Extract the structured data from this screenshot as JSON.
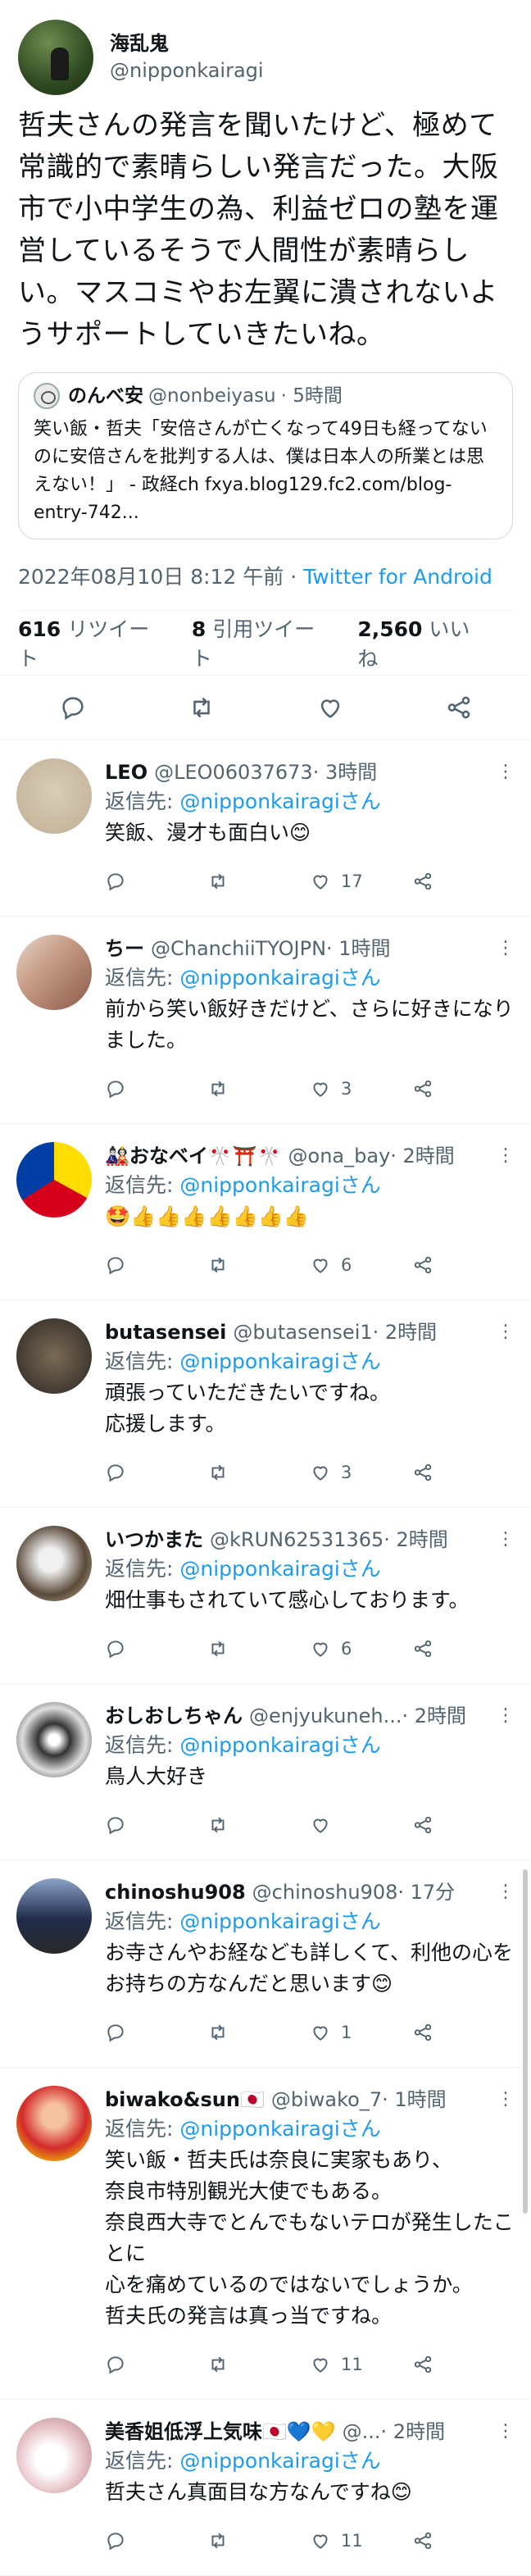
{
  "tweet": {
    "author_name": "海乱鬼",
    "author_handle": "@nipponkairagi",
    "text": "哲夫さんの発言を聞いたけど、極めて常識的で素晴らしい発言だった。大阪市で小中学生の為、利益ゼロの塾を運営しているそうで人間性が素晴らしい。マスコミやお左翼に潰されないようサポートしていきたいね。",
    "quote": {
      "author_name": "のんべ安",
      "author_handle": "@nonbeiyasu",
      "time": "· 5時間",
      "text": "笑い飯・哲夫「安倍さんが亡くなって49日も経ってないのに安倍さんを批判する人は、僕は日本人の所業とは思えない！」 - 政経ch fxya.blog129.fc2.com/blog-entry-742..."
    },
    "date": "2022年08月10日 8:12 午前 · ",
    "source": "Twitter for Android",
    "retweets_count": "616",
    "retweets_label": "リツイート",
    "quotes_count": "8",
    "quotes_label": "引用ツイート",
    "likes_count": "2,560",
    "likes_label": "いいね"
  },
  "replies": [
    {
      "name": "LEO",
      "handle": "@LEO06037673",
      "time": "· 3時間",
      "to_label": "返信先: ",
      "to_handle": "@nipponkairagiさん",
      "text": "笑飯、漫才も面白い😊",
      "replies": "",
      "retweets": "",
      "likes": "17"
    },
    {
      "name": "ちー",
      "handle": "@ChanchiiTYOJPN",
      "time": "· 1時間",
      "to_label": "返信先: ",
      "to_handle": "@nipponkairagiさん",
      "text": "前から笑い飯好きだけど、さらに好きになりました。",
      "replies": "",
      "retweets": "",
      "likes": "3"
    },
    {
      "name": "🎎おなベイ🎌⛩️🎌",
      "handle": "@ona_bay",
      "time": "· 2時間",
      "to_label": "返信先: ",
      "to_handle": "@nipponkairagiさん",
      "text": "🤩👍👍👍👍👍👍👍",
      "replies": "",
      "retweets": "",
      "likes": "6"
    },
    {
      "name": "butasensei",
      "handle": "@butasensei1",
      "time": "· 2時間",
      "to_label": "返信先: ",
      "to_handle": "@nipponkairagiさん",
      "text": "頑張っていただきたいですね。\n応援します。",
      "replies": "",
      "retweets": "",
      "likes": "3"
    },
    {
      "name": "いつかまた",
      "handle": "@kRUN62531365",
      "time": "· 2時間",
      "to_label": "返信先: ",
      "to_handle": "@nipponkairagiさん",
      "text": "畑仕事もされていて感心しております。",
      "replies": "",
      "retweets": "",
      "likes": "6"
    },
    {
      "name": "おしおしちゃん",
      "handle": "@enjyukuneh...",
      "time": "· 2時間",
      "to_label": "返信先: ",
      "to_handle": "@nipponkairagiさん",
      "text": "鳥人大好き",
      "replies": "",
      "retweets": "",
      "likes": ""
    },
    {
      "name": "chinoshu908",
      "handle": "@chinoshu908",
      "time": "· 17分",
      "to_label": "返信先: ",
      "to_handle": "@nipponkairagiさん",
      "text": "お寺さんやお経なども詳しくて、利他の心をお持ちの方なんだと思います😊",
      "replies": "",
      "retweets": "",
      "likes": "1"
    },
    {
      "name": "biwako&sun🇯🇵",
      "handle": "@biwako_7",
      "time": "· 1時間",
      "to_label": "返信先: ",
      "to_handle": "@nipponkairagiさん",
      "text": "笑い飯・哲夫氏は奈良に実家もあり、\n奈良市特別観光大使でもある。\n奈良西大寺でとんでもないテロが発生したことに\n心を痛めているのではないでしょうか。\n哲夫氏の発言は真っ当ですね。",
      "replies": "",
      "retweets": "",
      "likes": "11"
    },
    {
      "name": "美香姐低浮上気味🇯🇵💙💛",
      "handle": "@...",
      "time": "· 2時間",
      "to_label": "返信先: ",
      "to_handle": "@nipponkairagiさん",
      "text": "哲夫さん真面目な方なんですね😊",
      "replies": "",
      "retweets": "",
      "likes": "11"
    }
  ],
  "colors": {
    "accent": "#1d9bf0",
    "muted": "#536471",
    "text": "#0f1419",
    "border": "#eff3f4"
  },
  "icons": [
    "reply-icon",
    "retweet-icon",
    "like-icon",
    "share-icon",
    "more-icon"
  ]
}
